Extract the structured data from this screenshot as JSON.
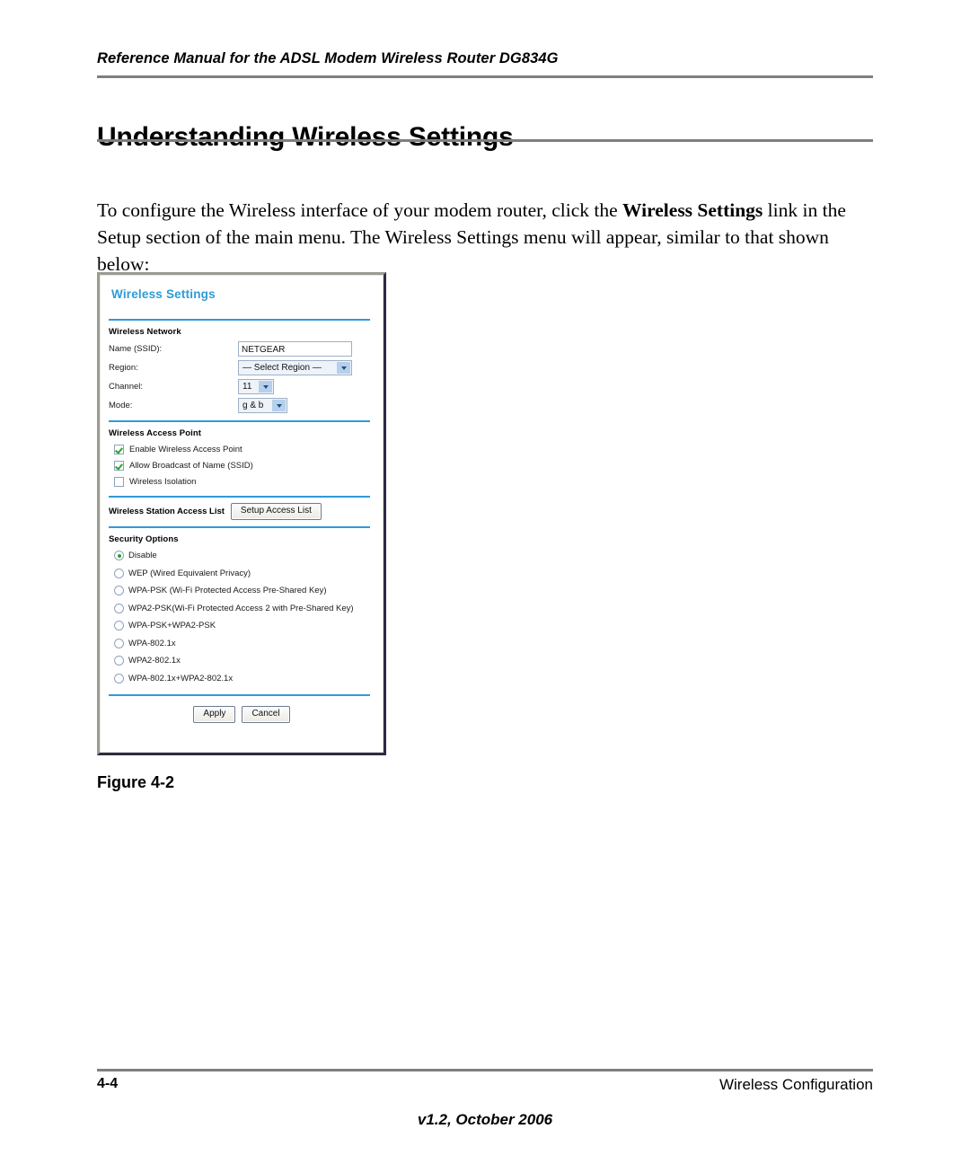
{
  "header": {
    "running_title": "Reference Manual for the ADSL Modem Wireless Router DG834G"
  },
  "heading": {
    "title": "Understanding Wireless Settings"
  },
  "body": {
    "paragraph_part1": "To configure the Wireless interface of your modem router, click the ",
    "paragraph_bold": "Wireless Settings",
    "paragraph_part2": " link in the Setup section of the main menu. The Wireless Settings menu will appear, similar to that shown below:"
  },
  "figure": {
    "caption": "Figure 4-2",
    "screenshot": {
      "title": "Wireless Settings",
      "accent_color": "#2e9bd6",
      "sections": {
        "wireless_network": {
          "heading": "Wireless Network",
          "fields": [
            {
              "label": "Name (SSID):",
              "control": "text",
              "value": "NETGEAR"
            },
            {
              "label": "Region:",
              "control": "select",
              "value": "— Select Region —"
            },
            {
              "label": "Channel:",
              "control": "select",
              "value": "11"
            },
            {
              "label": "Mode:",
              "control": "select",
              "value": "g & b"
            }
          ]
        },
        "wireless_access_point": {
          "heading": "Wireless Access Point",
          "checkboxes": [
            {
              "label": "Enable Wireless Access Point",
              "checked": true
            },
            {
              "label": "Allow Broadcast of Name (SSID)",
              "checked": true
            },
            {
              "label": "Wireless Isolation",
              "checked": false
            }
          ]
        },
        "station_access_list": {
          "label": "Wireless Station Access List",
          "button_label": "Setup Access List"
        },
        "security_options": {
          "heading": "Security Options",
          "options": [
            {
              "label": "Disable",
              "selected": true
            },
            {
              "label": "WEP (Wired Equivalent Privacy)",
              "selected": false
            },
            {
              "label": "WPA-PSK (Wi-Fi Protected Access Pre-Shared Key)",
              "selected": false
            },
            {
              "label": "WPA2-PSK(Wi-Fi Protected Access 2 with Pre-Shared Key)",
              "selected": false
            },
            {
              "label": "WPA-PSK+WPA2-PSK",
              "selected": false
            },
            {
              "label": "WPA-802.1x",
              "selected": false
            },
            {
              "label": "WPA2-802.1x",
              "selected": false
            },
            {
              "label": "WPA-802.1x+WPA2-802.1x",
              "selected": false
            }
          ]
        },
        "actions": {
          "apply_label": "Apply",
          "cancel_label": "Cancel"
        }
      }
    }
  },
  "footer": {
    "page_number": "4-4",
    "section_name": "Wireless Configuration",
    "version": "v1.2, October 2006"
  }
}
